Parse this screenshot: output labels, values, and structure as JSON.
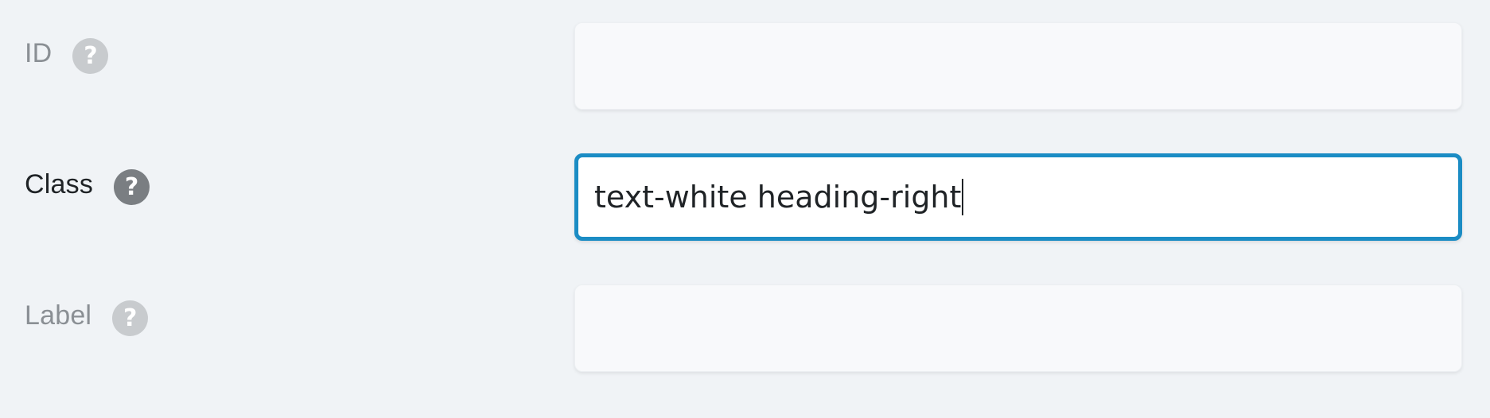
{
  "fields": {
    "id": {
      "label": "ID",
      "help_icon": "question-mark-icon",
      "value": "",
      "state": "disabled"
    },
    "class": {
      "label": "Class",
      "help_icon": "question-mark-icon",
      "value": "text-white heading-right",
      "state": "focused"
    },
    "label": {
      "label": "Label",
      "help_icon": "question-mark-icon",
      "value": "",
      "state": "disabled"
    }
  },
  "colors": {
    "background": "#f0f3f6",
    "focus_border": "#1b8cc4",
    "active_text": "#1f2326",
    "muted_text": "#8a8f94"
  },
  "help_glyph": "?"
}
